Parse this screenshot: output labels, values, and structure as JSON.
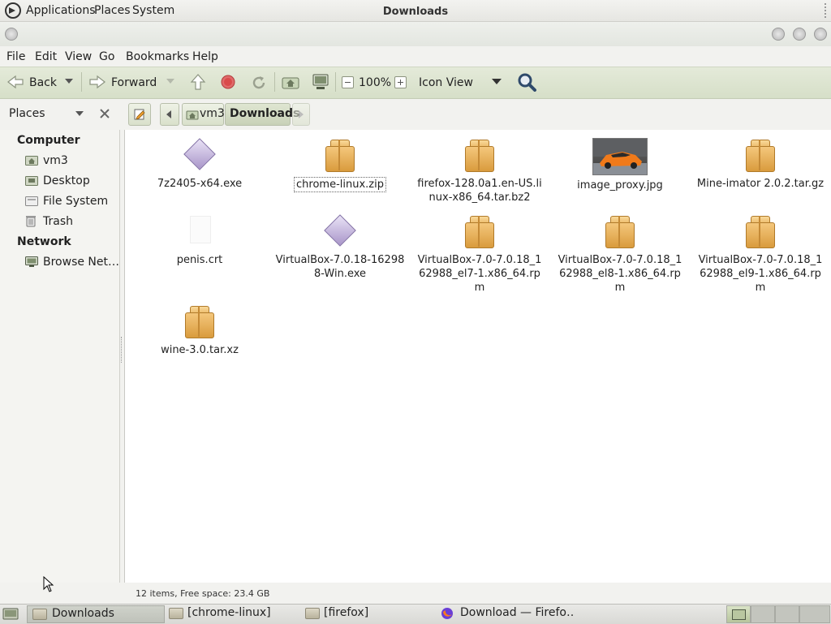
{
  "top_panel": {
    "menus": [
      "Applications",
      "Places",
      "System"
    ]
  },
  "window": {
    "title": "Downloads"
  },
  "menubar": [
    "File",
    "Edit",
    "View",
    "Go",
    "Bookmarks",
    "Help"
  ],
  "toolbar": {
    "back": "Back",
    "forward": "Forward",
    "zoom": "100%",
    "view_mode": "Icon View"
  },
  "sidebar": {
    "header": "Places",
    "sections": [
      {
        "title": "Computer",
        "items": [
          "vm3",
          "Desktop",
          "File System",
          "Trash"
        ]
      },
      {
        "title": "Network",
        "items": [
          "Browse Net…"
        ]
      }
    ]
  },
  "pathbar": {
    "crumbs": [
      "vm3",
      "Downloads"
    ]
  },
  "files": [
    {
      "name": "7z2405-x64.exe",
      "type": "exe"
    },
    {
      "name": "chrome-linux.zip",
      "type": "package",
      "selected": true
    },
    {
      "name": "firefox-128.0a1.en-US.linux-x86_64.tar.bz2",
      "type": "package"
    },
    {
      "name": "image_proxy.jpg",
      "type": "image"
    },
    {
      "name": "Mine-imator 2.0.2.tar.gz",
      "type": "package"
    },
    {
      "name": "penis.crt",
      "type": "document"
    },
    {
      "name": "VirtualBox-7.0.18-162988-Win.exe",
      "type": "exe"
    },
    {
      "name": "VirtualBox-7.0-7.0.18_162988_el7-1.x86_64.rpm",
      "type": "package"
    },
    {
      "name": "VirtualBox-7.0-7.0.18_162988_el8-1.x86_64.rpm",
      "type": "package"
    },
    {
      "name": "VirtualBox-7.0-7.0.18_162988_el9-1.x86_64.rpm",
      "type": "package"
    },
    {
      "name": "wine-3.0.tar.xz",
      "type": "package"
    }
  ],
  "status": "12 items, Free space: 23.4 GB",
  "taskbar": [
    "Downloads",
    "[chrome-linux]",
    "[firefox]",
    "Download — Firefo…"
  ],
  "colors": {
    "toolbar_bg": "#dfe6d2",
    "selection_border": "#666666",
    "stop_button": "#d94b4b"
  }
}
